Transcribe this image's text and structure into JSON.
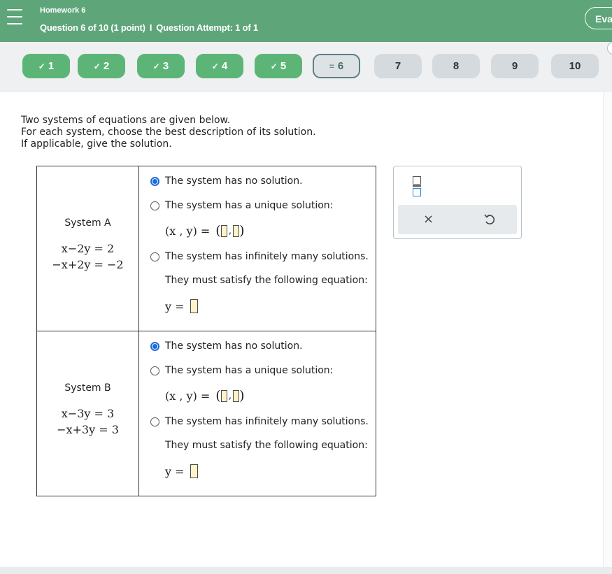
{
  "header": {
    "assignment": "Homework 6",
    "question_info": "Question 6 of 10 (1 point)",
    "separator": "I",
    "attempt_info": "Question Attempt: 1 of 1",
    "evaluate_label": "Eva",
    "menu_icon": "hamburger-icon",
    "bg_color": "#5ea57a"
  },
  "nav": {
    "questions": [
      {
        "num": "1",
        "status": "done"
      },
      {
        "num": "2",
        "status": "done"
      },
      {
        "num": "3",
        "status": "done"
      },
      {
        "num": "4",
        "status": "done"
      },
      {
        "num": "5",
        "status": "done"
      },
      {
        "num": "6",
        "status": "current"
      },
      {
        "num": "7",
        "status": "todo"
      },
      {
        "num": "8",
        "status": "todo"
      },
      {
        "num": "9",
        "status": "todo"
      },
      {
        "num": "10",
        "status": "todo"
      }
    ],
    "check_glyph": "✓",
    "current_glyph": "="
  },
  "instructions": {
    "line1": "Two systems of equations are given below.",
    "line2": "For each system, choose the best description of its solution.",
    "line3": "If applicable, give the solution."
  },
  "systems": [
    {
      "name": "System A",
      "eq1": "x−2y = 2",
      "eq2": "−x+2y = −2",
      "options": {
        "no_solution": "The system has no solution.",
        "unique": "The system has a unique solution:",
        "unique_expr": "(x , y) =",
        "infinite": "The system has infinitely many solutions.",
        "infinite_sub": "They must satisfy the following equation:",
        "infinite_expr": "y ="
      },
      "selected": "no_solution"
    },
    {
      "name": "System B",
      "eq1": "x−3y = 3",
      "eq2": "−x+3y = 3",
      "options": {
        "no_solution": "The system has no solution.",
        "unique": "The system has a unique solution:",
        "unique_expr": "(x , y) =",
        "infinite": "The system has infinitely many solutions.",
        "infinite_sub": "They must satisfy the following equation:",
        "infinite_expr": "y ="
      },
      "selected": "no_solution"
    }
  ],
  "toolpanel": {
    "fraction_icon": "fraction-icon",
    "clear_glyph": "×",
    "undo_icon": "undo-icon"
  },
  "colors": {
    "done": "#5cb577",
    "radio_selected": "#1a6cd9",
    "answer_box": "#fff3c8"
  }
}
